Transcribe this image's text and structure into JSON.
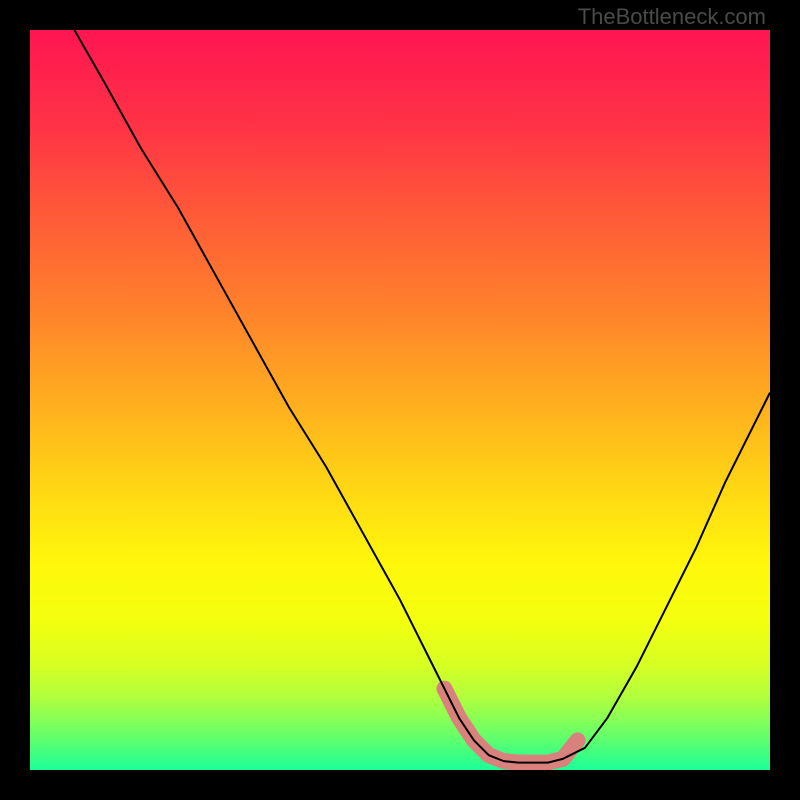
{
  "watermark": "TheBottleneck.com",
  "chart_data": {
    "type": "line",
    "title": "",
    "xlabel": "",
    "ylabel": "",
    "xlim": [
      0,
      100
    ],
    "ylim": [
      0,
      100
    ],
    "series": [
      {
        "name": "bottleneck-curve",
        "x": [
          6,
          10,
          15,
          20,
          25,
          30,
          35,
          40,
          45,
          50,
          54,
          56,
          58,
          60,
          62,
          64,
          66,
          68,
          70,
          72,
          75,
          78,
          82,
          86,
          90,
          94,
          98,
          100
        ],
        "values": [
          100,
          93,
          84,
          76,
          67,
          58,
          49,
          41,
          32,
          23,
          15,
          11,
          7,
          4,
          2,
          1.2,
          1,
          1,
          1,
          1.5,
          3,
          7,
          14,
          22,
          30,
          39,
          47,
          51
        ]
      }
    ],
    "markers": {
      "name": "bottom-highlight",
      "color": "#d9827d",
      "stroke_width": 16,
      "x": [
        56,
        58,
        60,
        62,
        64,
        66,
        68,
        70,
        72,
        74
      ],
      "values": [
        11,
        7,
        4,
        2,
        1.2,
        1,
        1,
        1,
        1.5,
        4
      ]
    },
    "background_gradient": {
      "stops": [
        {
          "pos": 0,
          "color": "#ff1552"
        },
        {
          "pos": 13,
          "color": "#ff3346"
        },
        {
          "pos": 25,
          "color": "#ff5a38"
        },
        {
          "pos": 38,
          "color": "#ff822b"
        },
        {
          "pos": 50,
          "color": "#ffad1f"
        },
        {
          "pos": 62,
          "color": "#ffd714"
        },
        {
          "pos": 72,
          "color": "#fff70b"
        },
        {
          "pos": 80,
          "color": "#f3ff0e"
        },
        {
          "pos": 86,
          "color": "#d5ff24"
        },
        {
          "pos": 90,
          "color": "#b2ff3c"
        },
        {
          "pos": 93,
          "color": "#8aff55"
        },
        {
          "pos": 96,
          "color": "#5cff70"
        },
        {
          "pos": 100,
          "color": "#1bff97"
        }
      ]
    }
  }
}
